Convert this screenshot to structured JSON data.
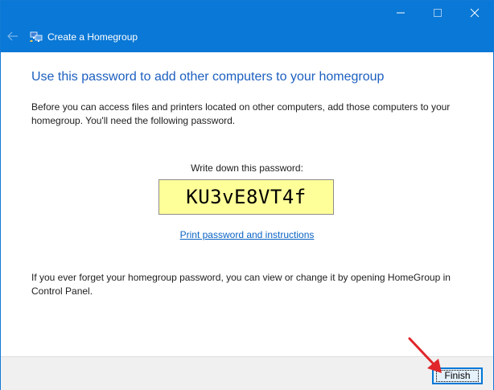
{
  "window": {
    "title": "Create a Homegroup",
    "controls": {
      "minimize_icon": "minimize-icon",
      "maximize_icon": "maximize-icon",
      "close_icon": "close-icon"
    }
  },
  "main": {
    "heading": "Use this password to add other computers to your homegroup",
    "intro": "Before you can access files and printers located on other computers, add those computers to your homegroup. You'll need the following password.",
    "password_label": "Write down this password:",
    "password": "KU3vE8VT4f",
    "print_link": "Print password and instructions",
    "forgot_note": "If you ever forget your homegroup password, you can view or change it by opening HomeGroup in Control Panel."
  },
  "footer": {
    "finish_label": "Finish"
  },
  "colors": {
    "titlebar": "#0a78d6",
    "heading": "#1c5fbf",
    "password_bg": "#ffff99",
    "link": "#0a63c4",
    "annotation_arrow": "#e0262b"
  }
}
